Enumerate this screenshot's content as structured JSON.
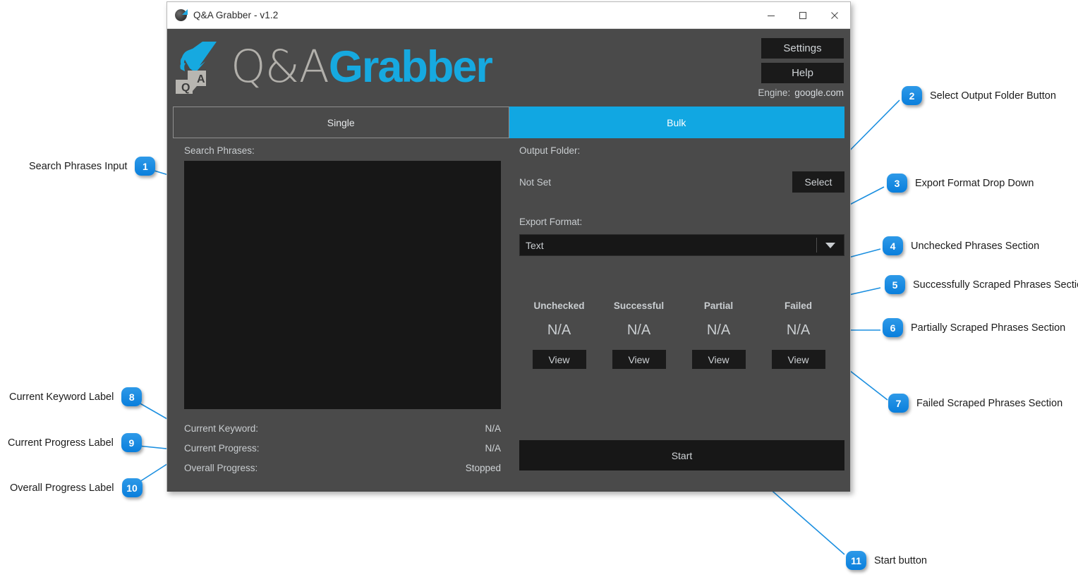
{
  "window": {
    "title": "Q&A Grabber - v1.2",
    "icon": "app-icon",
    "controls": {
      "minimize": "minimize-icon",
      "maximize": "maximize-icon",
      "close": "close-icon"
    }
  },
  "brand": {
    "logo_qa": "Q&A",
    "logo_grabber": "Grabber",
    "logo_mark": "hand-grabbing-qa-bubbles-icon",
    "accent_color": "#16a9e0",
    "panel_color": "#4a4a4a",
    "field_color": "#171717"
  },
  "header": {
    "settings_label": "Settings",
    "help_label": "Help",
    "engine_label": "Engine:",
    "engine_value": "google.com"
  },
  "tabs": [
    {
      "label": "Single",
      "active": false
    },
    {
      "label": "Bulk",
      "active": true
    }
  ],
  "left_panel": {
    "search_phrases_label": "Search Phrases:",
    "search_phrases_value": "",
    "status": [
      {
        "label": "Current Keyword:",
        "value": "N/A"
      },
      {
        "label": "Current Progress:",
        "value": "N/A"
      },
      {
        "label": "Overall Progress:",
        "value": "Stopped"
      }
    ]
  },
  "right_panel": {
    "output_folder_label": "Output Folder:",
    "output_folder_value": "Not Set",
    "select_label": "Select",
    "export_format_label": "Export Format:",
    "export_format_value": "Text",
    "export_format_options": [
      "Text"
    ],
    "stats": [
      {
        "name": "Unchecked",
        "value": "N/A",
        "button": "View"
      },
      {
        "name": "Successful",
        "value": "N/A",
        "button": "View"
      },
      {
        "name": "Partial",
        "value": "N/A",
        "button": "View"
      },
      {
        "name": "Failed",
        "value": "N/A",
        "button": "View"
      }
    ],
    "start_label": "Start"
  },
  "callouts": [
    {
      "num": "1",
      "text": "Search Phrases Input"
    },
    {
      "num": "2",
      "text": "Select Output Folder Button"
    },
    {
      "num": "3",
      "text": "Export Format Drop Down"
    },
    {
      "num": "4",
      "text": "Unchecked Phrases Section"
    },
    {
      "num": "5",
      "text": "Successfully Scraped Phrases Section"
    },
    {
      "num": "6",
      "text": "Partially Scraped Phrases Section"
    },
    {
      "num": "7",
      "text": "Failed Scraped Phrases Section"
    },
    {
      "num": "8",
      "text": "Current Keyword Label"
    },
    {
      "num": "9",
      "text": "Current Progress Label"
    },
    {
      "num": "10",
      "text": "Overall Progress Label"
    },
    {
      "num": "11",
      "text": "Start button"
    }
  ]
}
